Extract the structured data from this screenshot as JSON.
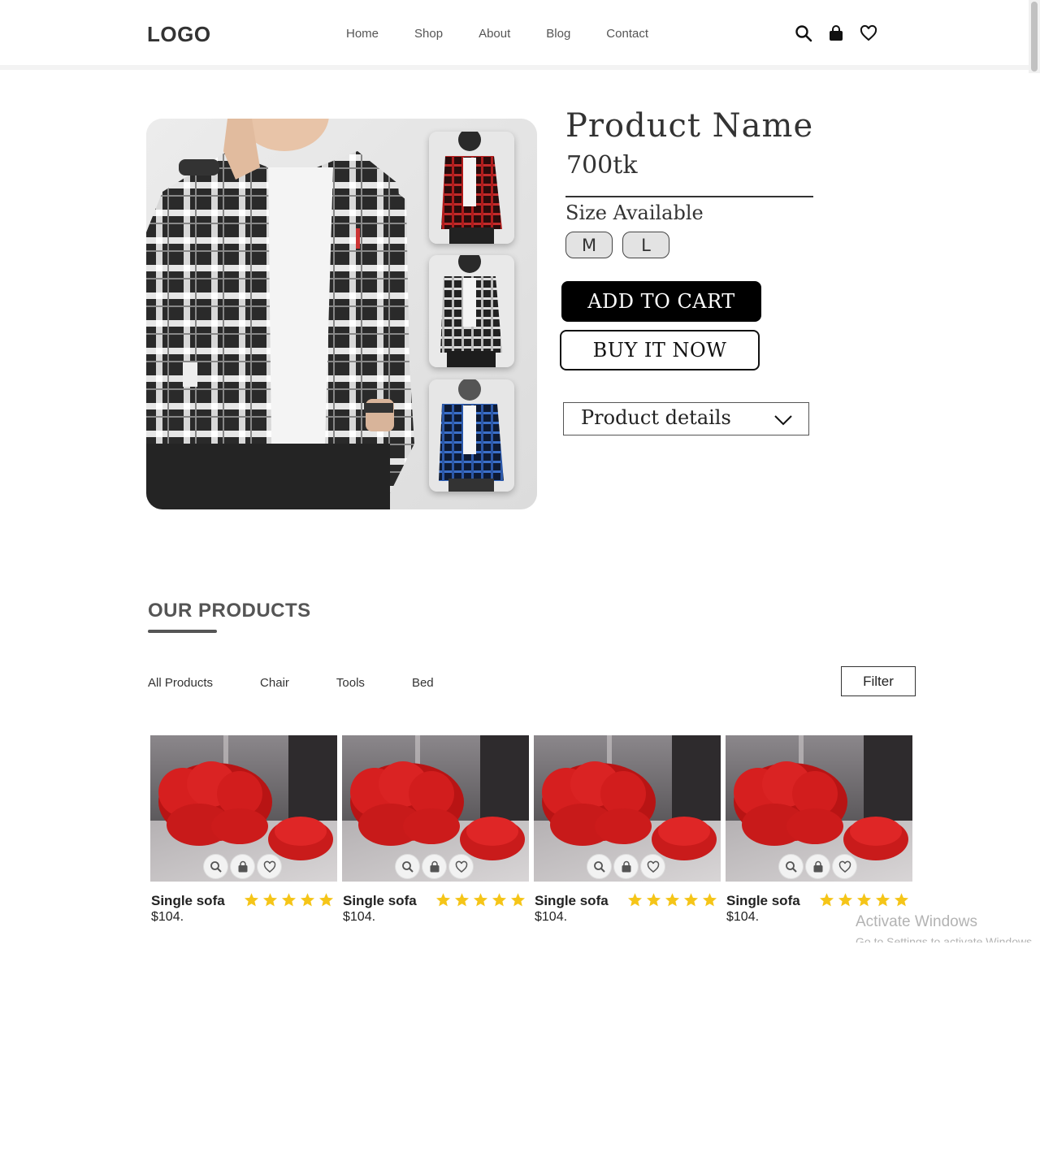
{
  "header": {
    "logo": "LOGO",
    "nav": [
      "Home",
      "Shop",
      "About",
      "Blog",
      "Contact"
    ],
    "icons": [
      "search-icon",
      "bag-icon",
      "heart-icon"
    ]
  },
  "product": {
    "name": "Product Name",
    "price": "700tk",
    "size_label": "Size Available",
    "sizes": [
      "M",
      "L"
    ],
    "add_to_cart": "ADD TO CART",
    "buy_now": "BUY IT NOW",
    "details_label": "Product details"
  },
  "products_section": {
    "title": "OUR PRODUCTS",
    "filters": [
      "All Products",
      "Chair",
      "Tools",
      "Bed"
    ],
    "filter_button": "Filter",
    "items": [
      {
        "name": "Single sofa",
        "price": "$104.",
        "rating": 5
      },
      {
        "name": "Single sofa",
        "price": "$104.",
        "rating": 5
      },
      {
        "name": "Single sofa",
        "price": "$104.",
        "rating": 5
      },
      {
        "name": "Single sofa",
        "price": "$104.",
        "rating": 5
      }
    ]
  },
  "watermark": {
    "line1": "Activate Windows",
    "line2": "Go to Settings to activate Windows."
  },
  "colors": {
    "star": "#f5c518",
    "sofa": "#d81e1e",
    "button_dark": "#000000"
  }
}
